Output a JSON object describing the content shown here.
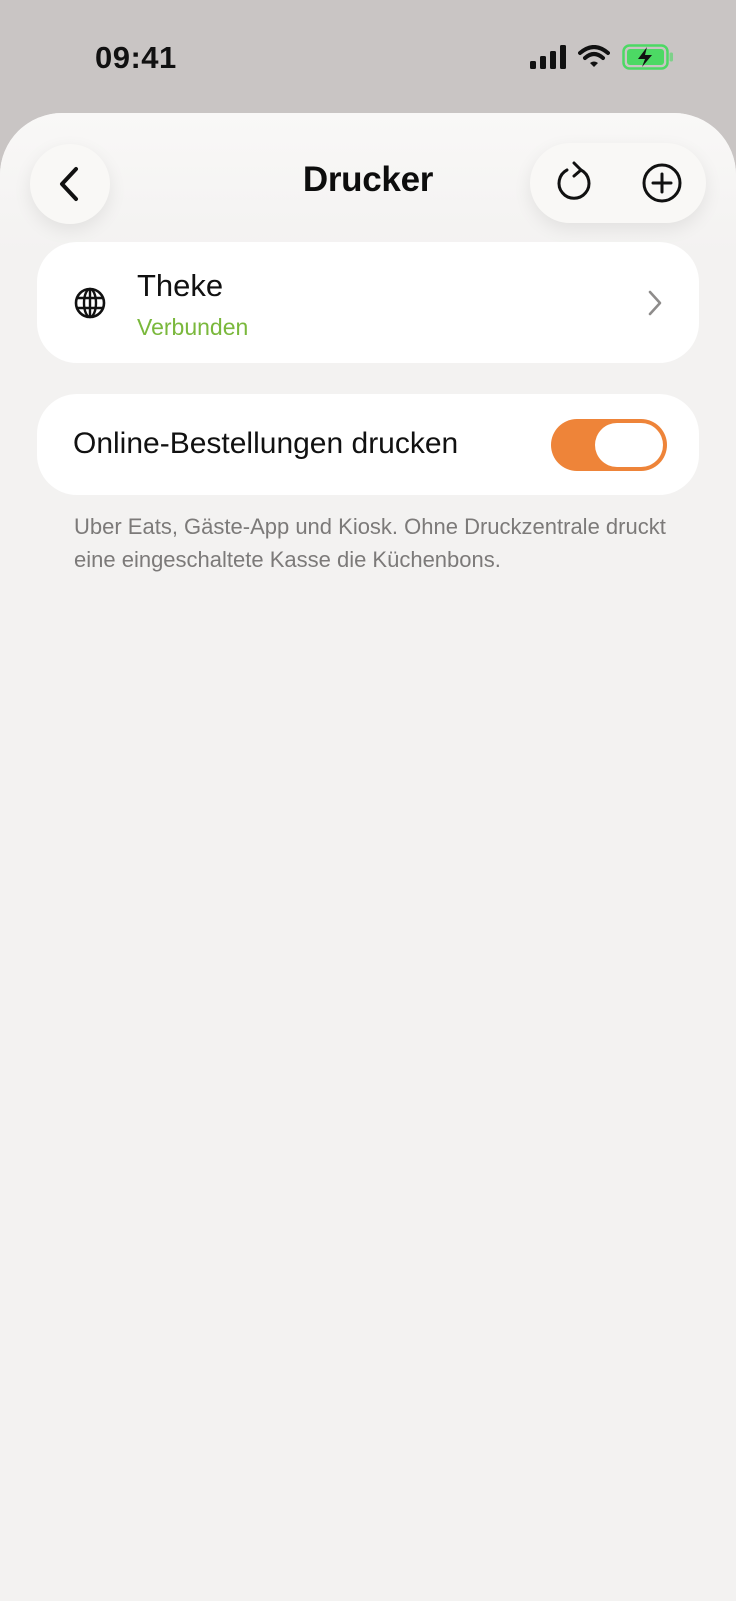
{
  "status_bar": {
    "time": "09:41"
  },
  "header": {
    "title": "Drucker"
  },
  "printers": [
    {
      "name": "Theke",
      "status": "Verbunden",
      "icon": "globe-icon"
    }
  ],
  "settings": {
    "online_orders_label": "Online-Bestellungen drucken",
    "online_orders_enabled": true,
    "footnote": "Uber Eats, Gäste-App und Kiosk. Ohne Druckzentrale druckt eine eingeschaltete Kasse die Küchenbons."
  },
  "icons": {
    "back": "chevron-left-icon",
    "refresh": "refresh-icon",
    "add": "plus-circle-icon",
    "chevron": "chevron-right-icon"
  },
  "colors": {
    "accent": "#ee8439",
    "connected": "#7ab83c",
    "battery": "#4cd964"
  }
}
